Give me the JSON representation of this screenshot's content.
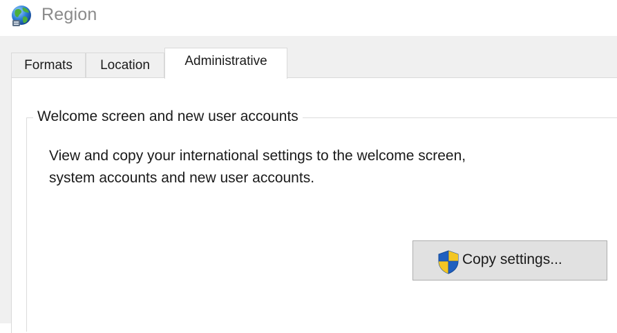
{
  "window": {
    "title": "Region",
    "title_icon": "globe-region-icon"
  },
  "tabs": [
    {
      "label": "Formats",
      "selected": false
    },
    {
      "label": "Location",
      "selected": false
    },
    {
      "label": "Administrative",
      "selected": true
    }
  ],
  "administrative": {
    "group_title": "Welcome screen and new user accounts",
    "description_line1": "View and copy your international settings to the welcome screen,",
    "description_line2": "system accounts and new user accounts.",
    "copy_button_label": "Copy settings...",
    "copy_button_icon": "uac-shield-icon"
  },
  "colors": {
    "dialog_background": "#f0f0f0",
    "panel_background": "#ffffff",
    "button_background": "#e1e1e1",
    "button_border": "#adadad",
    "title_text": "#8a8a8a",
    "shield_blue": "#1f5fbf",
    "shield_yellow": "#f3c623"
  }
}
